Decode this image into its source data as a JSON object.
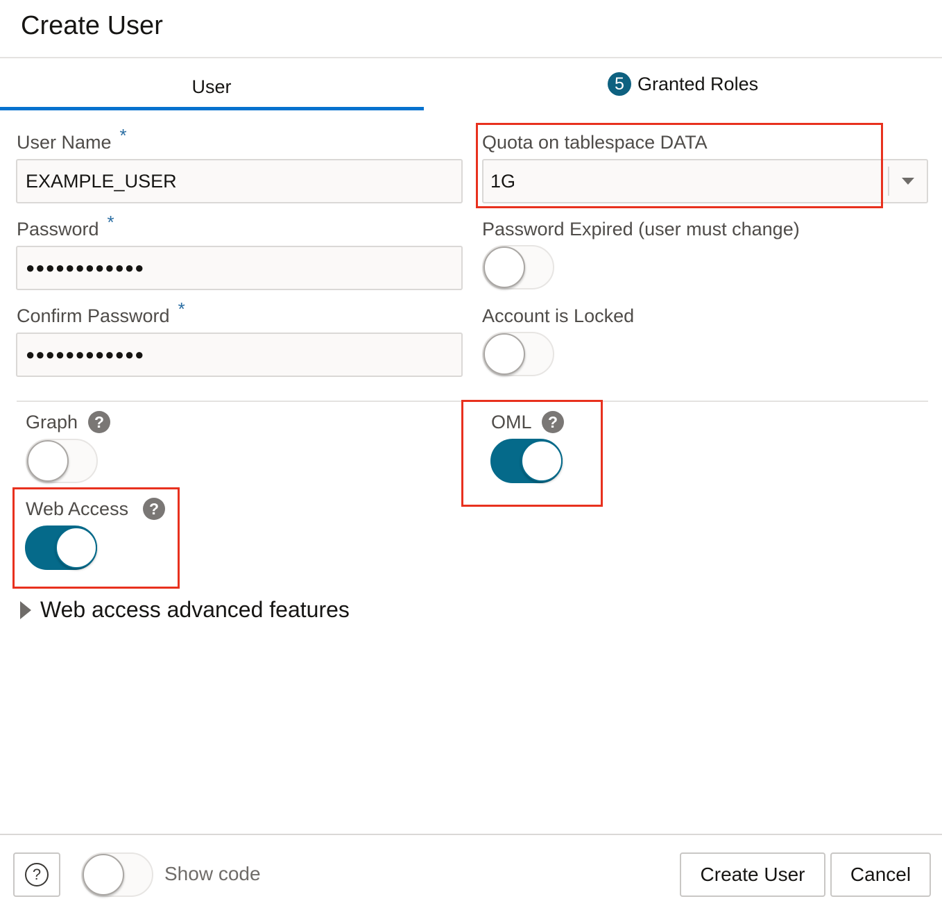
{
  "dialog": {
    "title": "Create User"
  },
  "tabs": {
    "user": "User",
    "roles_count": "5",
    "roles_label": "Granted Roles"
  },
  "fields": {
    "username": {
      "label": "User Name",
      "required_mark": "*",
      "value": "EXAMPLE_USER"
    },
    "password": {
      "label": "Password",
      "required_mark": "*",
      "value": "●●●●●●●●●●●●"
    },
    "confirm_password": {
      "label": "Confirm Password",
      "required_mark": "*",
      "value": "●●●●●●●●●●●●"
    },
    "quota": {
      "label": "Quota on tablespace DATA",
      "value": "1G"
    },
    "password_expired": {
      "label": "Password Expired (user must change)",
      "on": false
    },
    "account_locked": {
      "label": "Account is Locked",
      "on": false
    }
  },
  "features": {
    "graph": {
      "label": "Graph",
      "help": "?",
      "on": false
    },
    "oml": {
      "label": "OML",
      "help": "?",
      "on": true
    },
    "web_access": {
      "label": "Web Access",
      "help": "?",
      "on": true
    }
  },
  "advanced": {
    "label": "Web access advanced features"
  },
  "footer": {
    "help_glyph": "?",
    "show_code_label": "Show code",
    "create_label": "Create User",
    "cancel_label": "Cancel"
  },
  "colors": {
    "accent": "#0572ce",
    "toggle_on": "#056a8a",
    "highlight": "#e8311e"
  }
}
